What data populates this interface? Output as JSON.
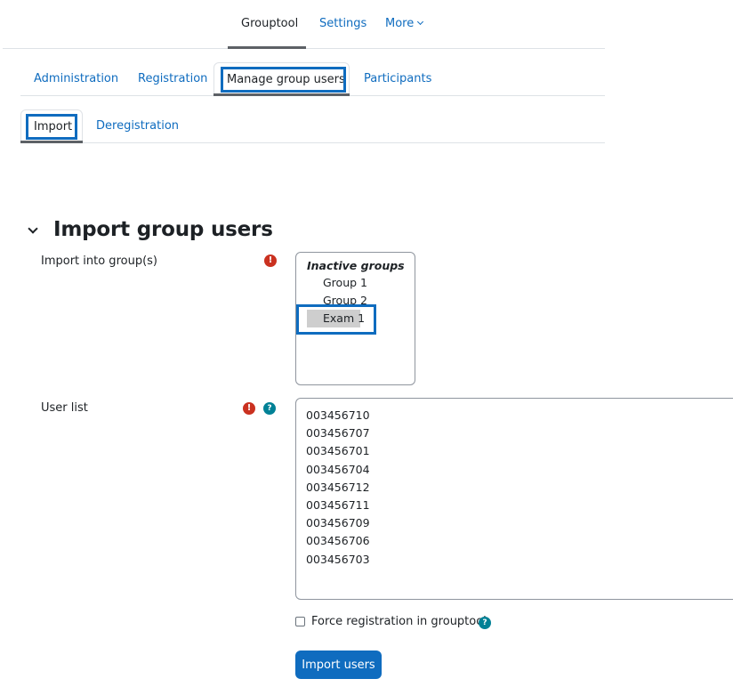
{
  "secondary_nav": {
    "items": [
      {
        "label": "Grouptool",
        "active": true
      },
      {
        "label": "Settings",
        "active": false
      },
      {
        "label": "More",
        "active": false,
        "icon": "chevron-down-icon"
      }
    ]
  },
  "tabs": {
    "items": [
      {
        "label": "Administration",
        "active": false
      },
      {
        "label": "Registration",
        "active": false
      },
      {
        "label": "Manage group users",
        "active": true,
        "highlighted": true
      },
      {
        "label": "Participants",
        "active": false
      }
    ]
  },
  "subtabs": {
    "items": [
      {
        "label": "Import",
        "active": true,
        "highlighted": true
      },
      {
        "label": "Deregistration",
        "active": false
      }
    ]
  },
  "section": {
    "title": "Import group users",
    "collapse_icon": "chevron-down-icon"
  },
  "form": {
    "groups_field": {
      "label": "Import into group(s)",
      "required_icon": "!",
      "optgroup_label": "Inactive groups",
      "options": [
        {
          "label": "Group 1",
          "selected": false
        },
        {
          "label": "Group 2",
          "selected": false
        },
        {
          "label": "Exam 1",
          "selected": true,
          "highlighted": true
        }
      ]
    },
    "userlist_field": {
      "label": "User list",
      "required_icon": "!",
      "help_icon": "?",
      "lines": [
        "003456710",
        "003456707",
        "003456701",
        "003456704",
        "003456712",
        "003456711",
        "003456709",
        "003456706",
        "003456703"
      ]
    },
    "force_registration": {
      "label": "Force registration in grouptool",
      "checked": false,
      "help_icon": "?"
    },
    "submit_label": "Import users"
  },
  "colors": {
    "accent": "#0f6cbf",
    "highlight_box": "#0f6cbf",
    "required": "#ca3120",
    "help": "#008196",
    "selected_option_bg": "#cecece"
  }
}
